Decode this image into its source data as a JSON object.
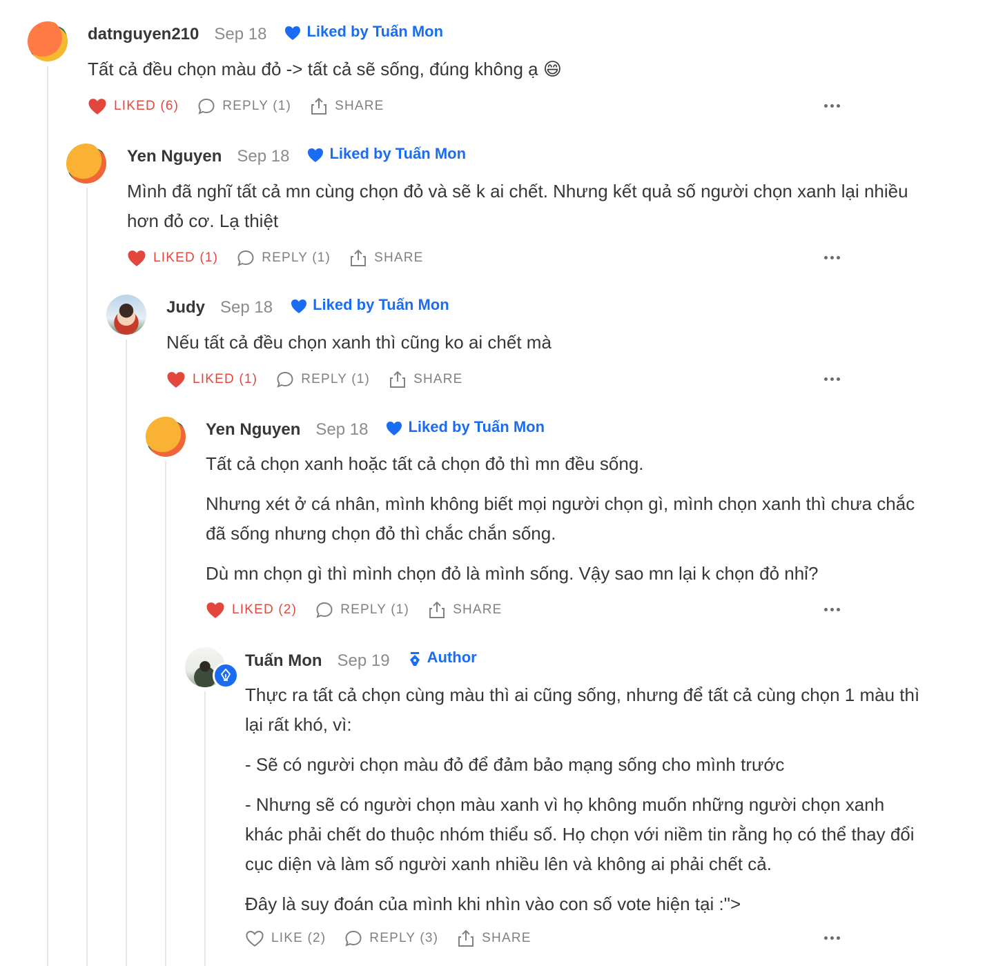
{
  "liked_by_label": "Liked by Tuấn Mon",
  "actions": {
    "reply": "REPLY",
    "share": "SHARE"
  },
  "comments": [
    {
      "name": "datnguyen210",
      "date": "Sep 18",
      "liked_by": "Liked by Tuấn Mon",
      "body": [
        "Tất cả đều chọn màu đỏ -> tất cả sẽ sống, đúng không ạ 😄"
      ],
      "like_label": "LIKED (6)",
      "reply_label": "REPLY (1)",
      "share_label": "SHARE"
    },
    {
      "name": "Yen Nguyen",
      "date": "Sep 18",
      "liked_by": "Liked by Tuấn Mon",
      "body": [
        "Mình đã nghĩ tất cả mn cùng chọn đỏ và sẽ k ai chết. Nhưng kết quả số người chọn xanh lại nhiều hơn đỏ cơ. Lạ thiệt"
      ],
      "like_label": "LIKED (1)",
      "reply_label": "REPLY (1)",
      "share_label": "SHARE"
    },
    {
      "name": "Judy",
      "date": "Sep 18",
      "liked_by": "Liked by Tuấn Mon",
      "body": [
        "Nếu tất cả đều chọn xanh thì cũng ko ai chết mà"
      ],
      "like_label": "LIKED (1)",
      "reply_label": "REPLY (1)",
      "share_label": "SHARE"
    },
    {
      "name": "Yen Nguyen",
      "date": "Sep 18",
      "liked_by": "Liked by Tuấn Mon",
      "body": [
        "Tất cả chọn xanh hoặc tất cả chọn đỏ thì mn đều sống.",
        "Nhưng xét ở cá nhân, mình không biết mọi người chọn gì, mình chọn xanh thì chưa chắc đã sống nhưng chọn đỏ thì chắc chắn sống.",
        "Dù mn chọn gì thì mình chọn đỏ là mình sống. Vậy sao mn lại k chọn đỏ nhỉ?"
      ],
      "like_label": "LIKED (2)",
      "reply_label": "REPLY (1)",
      "share_label": "SHARE"
    },
    {
      "name": "Tuấn Mon",
      "date": "Sep 19",
      "author_label": "Author",
      "body": [
        "Thực ra tất cả chọn cùng màu thì ai cũng sống, nhưng để tất cả cùng chọn 1 màu thì lại rất khó, vì:",
        "- Sẽ có người chọn màu đỏ để đảm bảo mạng sống cho mình trước",
        "- Nhưng sẽ có người chọn màu xanh vì họ không muốn những người chọn xanh khác phải chết do thuộc nhóm thiểu số. Họ chọn với niềm tin rằng họ có thể thay đổi cục diện và làm số người xanh nhiều lên và không ai phải chết cả.",
        "Đây là suy đoán của mình khi nhìn vào con số vote hiện tại :\">"
      ],
      "like_label": "LIKE (2)",
      "reply_label": "REPLY (3)",
      "share_label": "SHARE"
    }
  ],
  "colors": {
    "accent_blue": "#1a6cf3",
    "liked_red": "#e2463d",
    "text": "#363737",
    "muted": "#8b8b8b"
  }
}
